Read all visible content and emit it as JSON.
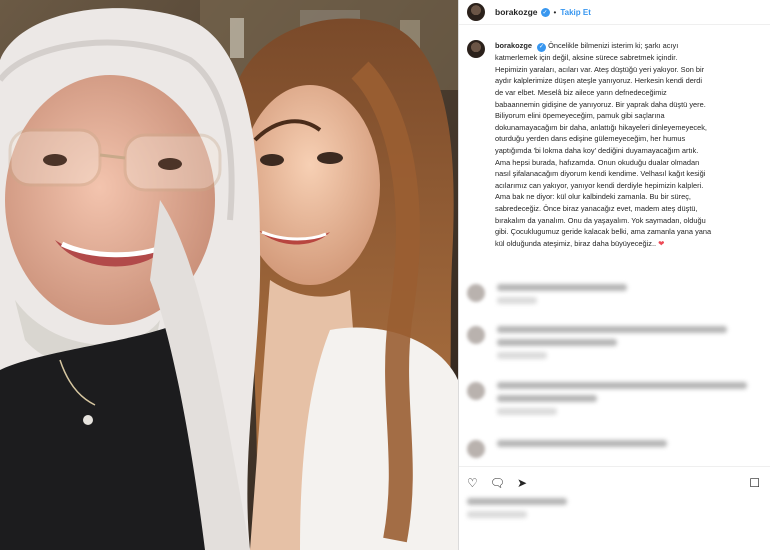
{
  "post": {
    "username": "borakozge",
    "verified_icon": "verified-badge-icon",
    "separator": "•",
    "follow_label": "Takip Et",
    "caption_lines": [
      "Öncelikle bilmenizi isterim ki; şarkı acıyı",
      "katmerlemek için değil, aksine sürece sabretmek içindir.",
      "Hepimizin yaraları, acıları var. Ateş düştüğü yeri yakıyor. Son bir",
      "aydır kalplerimize düşen ateşle yanıyoruz. Herkesin kendi derdi",
      "de var elbet. Meselâ biz ailece yarın defnedeceğimiz",
      "babaannemin gidişine de yanıyoruz. Bir yaprak daha düştü yere.",
      "Biliyorum elini öpemeyeceğim, pamuk gibi saçlarına",
      "dokunamayacağım bir daha, anlattığı hikayeleri dinleyemeyecek,",
      "oturduğu yerden dans edişine gülemeyeceğim, her humus",
      "yaptığımda 'bi lokma daha koy' dediğini duyamayacağım artık.",
      "Ama hepsi burada, hafızamda. Onun okuduğu dualar olmadan",
      "nasıl şifalanacağım diyorum kendi kendime. Velhasıl kağıt kesiği",
      "acılarımız can yakıyor, yanıyor kendi derdiyle hepimizin kalpleri.",
      "Ama bak ne diyor: kül olur kalbindeki zamanla. Bu bir süreç,",
      "sabredeceğiz. Önce biraz yanacağız evet, madem ateş düştü,",
      "bırakalım da yanalım. Onu da yaşayalım. Yok saymadan, olduğu",
      "gibi. Çocuklugumuz geride kalacak belki, ama zamanla yana yana",
      "kül olduğunda ateşimiz, biraz daha büyüyeceğiz.."
    ],
    "heart_glyph": "❤"
  },
  "icons": {
    "like": "heart-outline-icon",
    "comment": "comment-icon",
    "share": "share-icon",
    "save": "bookmark-icon"
  },
  "colors": {
    "accent": "#3897f0",
    "heart": "#ed4956"
  }
}
